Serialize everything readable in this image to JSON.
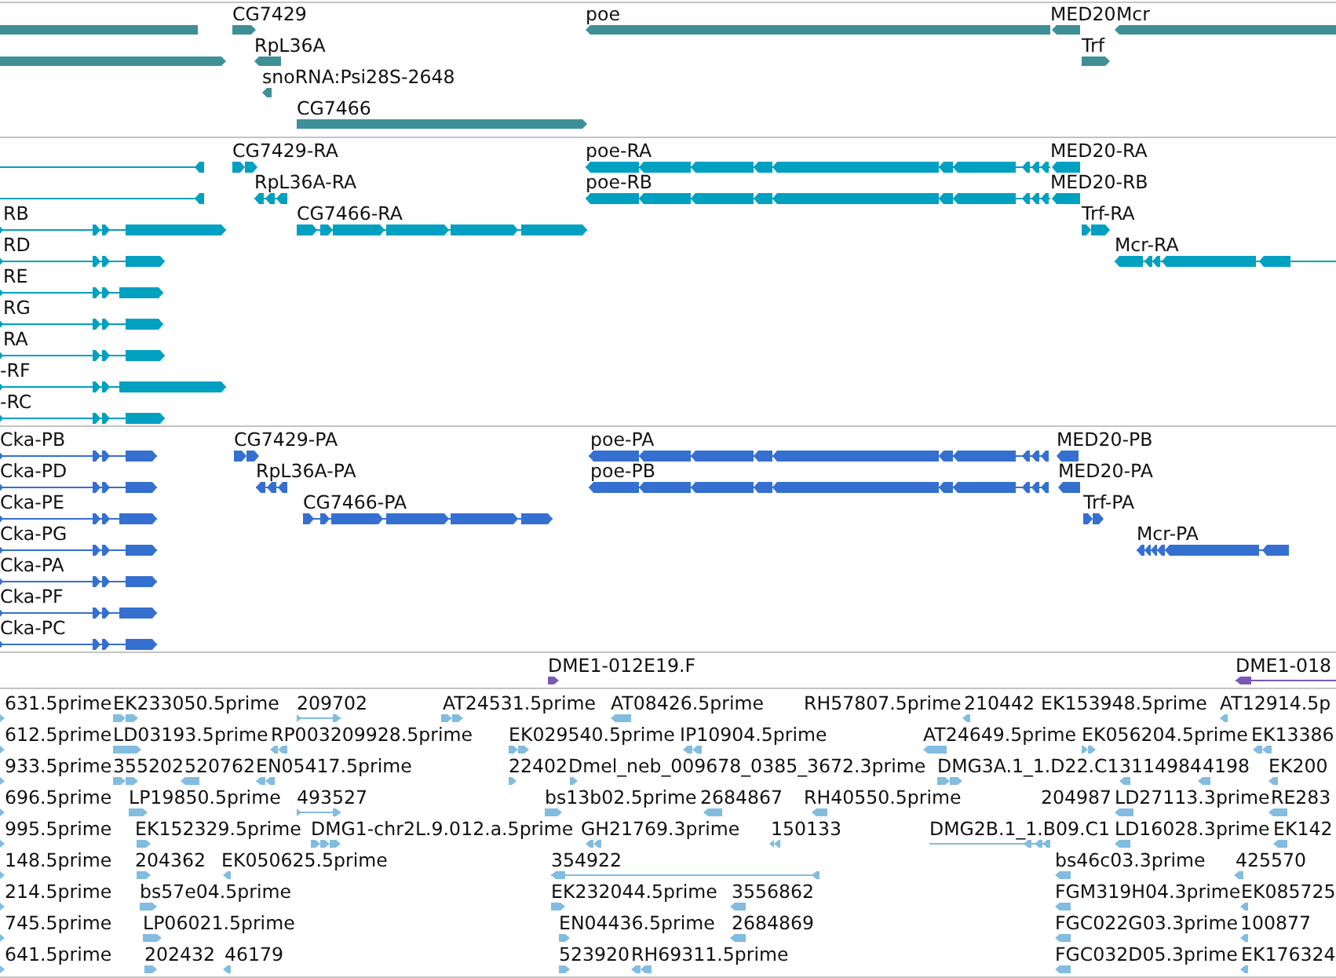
{
  "tracks": [
    {
      "kind": "gene",
      "rows": [
        {
          "features": [
            {
              "reverse": true
            },
            {
              "label": "CG7429",
              "reverse": false
            },
            {
              "label": "poe",
              "reverse": true
            },
            {
              "label": "MED20",
              "reverse": true
            },
            {
              "label": "Mcr",
              "reverse": true
            }
          ]
        },
        {
          "features": [
            {
              "reverse": false
            },
            {
              "label": "RpL36A",
              "reverse": true
            },
            {
              "label": "Trf",
              "reverse": false
            }
          ]
        },
        {
          "features": [
            {
              "label": "snoRNA:Psi28S-2648",
              "reverse": true
            }
          ]
        },
        {
          "features": [
            {
              "label": "CG7466",
              "reverse": false
            }
          ]
        }
      ]
    },
    {
      "kind": "transcript",
      "rows": [
        {
          "features": [
            {
              "reverse": true
            },
            {
              "label": "CG7429-RA",
              "reverse": false
            },
            {
              "label": "poe-RA",
              "reverse": true
            },
            {
              "label": "MED20-RA",
              "reverse": true
            }
          ]
        },
        {
          "features": [
            {
              "reverse": true
            },
            {
              "label": "RpL36A-RA",
              "reverse": true
            },
            {
              "label": "poe-RB",
              "reverse": true
            },
            {
              "label": "MED20-RB",
              "reverse": true
            }
          ]
        },
        {
          "features": [
            {
              "label": "RB",
              "reverse": false
            },
            {
              "label": "CG7466-RA",
              "reverse": false
            },
            {
              "label": "Trf-RA",
              "reverse": false
            }
          ]
        },
        {
          "features": [
            {
              "label": "RD",
              "reverse": false
            },
            {
              "label": "Mcr-RA",
              "reverse": true
            }
          ]
        },
        {
          "features": [
            {
              "label": "RE",
              "reverse": false
            }
          ]
        },
        {
          "features": [
            {
              "label": "RG",
              "reverse": false
            }
          ]
        },
        {
          "features": [
            {
              "label": "RA",
              "reverse": false
            }
          ]
        },
        {
          "features": [
            {
              "label": "-RF",
              "reverse": false
            }
          ]
        },
        {
          "features": [
            {
              "label": "-RC",
              "reverse": false
            }
          ]
        }
      ]
    },
    {
      "kind": "protein",
      "rows": [
        {
          "features": [
            {
              "label": "Cka-PB",
              "reverse": false
            },
            {
              "label": "CG7429-PA",
              "reverse": false
            },
            {
              "label": "poe-PA",
              "reverse": true
            },
            {
              "label": "MED20-PB",
              "reverse": true
            }
          ]
        },
        {
          "features": [
            {
              "label": "Cka-PD",
              "reverse": false
            },
            {
              "label": "RpL36A-PA",
              "reverse": true
            },
            {
              "label": "poe-PB",
              "reverse": true
            },
            {
              "label": "MED20-PA",
              "reverse": true
            }
          ]
        },
        {
          "features": [
            {
              "label": "Cka-PE",
              "reverse": false
            },
            {
              "label": "CG7466-PA",
              "reverse": false
            },
            {
              "label": "Trf-PA",
              "reverse": false
            }
          ]
        },
        {
          "features": [
            {
              "label": "Cka-PG",
              "reverse": false
            },
            {
              "label": "Mcr-PA",
              "reverse": true
            }
          ]
        },
        {
          "features": [
            {
              "label": "Cka-PA",
              "reverse": false
            }
          ]
        },
        {
          "features": [
            {
              "label": "Cka-PF",
              "reverse": false
            }
          ]
        },
        {
          "features": [
            {
              "label": "Cka-PC",
              "reverse": false
            }
          ]
        }
      ]
    },
    {
      "kind": "clone",
      "rows": [
        {
          "features": [
            {
              "label": "DME1-012E19.F",
              "reverse": false
            },
            {
              "label": "DME1-018",
              "reverse": true
            }
          ]
        }
      ]
    },
    {
      "kind": "est",
      "rows": [
        {
          "features": [
            {
              "label": "631.5prime",
              "reverse": false
            },
            {
              "label": "EK233050.5prime",
              "reverse": false
            },
            {
              "label": "209702",
              "reverse": false
            },
            {
              "label": "AT24531.5prime",
              "reverse": false
            },
            {
              "label": "AT08426.5prime",
              "reverse": true
            },
            {
              "label": "RH57807.5prime"
            },
            {
              "label": "210442",
              "reverse": true
            },
            {
              "label": "EK153948.5prime"
            },
            {
              "label": "AT12914.5p",
              "reverse": true
            }
          ]
        },
        {
          "features": [
            {
              "label": "612.5prime",
              "reverse": false
            },
            {
              "label": "LD03193.5prime",
              "reverse": false
            },
            {
              "label": "RP003209928.5prime",
              "reverse": true
            },
            {
              "label": "EK029540.5prime",
              "reverse": false
            },
            {
              "label": "IP10904.5prime",
              "reverse": true
            },
            {
              "label": "AT24649.5prime",
              "reverse": true
            },
            {
              "label": "EK056204.5prime",
              "reverse": false
            },
            {
              "label": "EK13386",
              "reverse": true
            }
          ]
        },
        {
          "features": [
            {
              "label": "933.5prime",
              "reverse": false
            },
            {
              "label": "355202",
              "reverse": false
            },
            {
              "label": "520762",
              "reverse": true
            },
            {
              "label": "EN05417.5prime",
              "reverse": true
            },
            {
              "label": "22402",
              "reverse": false
            },
            {
              "label": "Dmel_neb_009678_0385_3672.3prime",
              "reverse": false
            },
            {
              "label": "DMG3A.1_1.D22.C1",
              "reverse": false
            },
            {
              "label": "3114984",
              "reverse": true
            },
            {
              "label": "4198",
              "reverse": true
            },
            {
              "label": "EK200",
              "reverse": true
            }
          ]
        },
        {
          "features": [
            {
              "label": "696.5prime",
              "reverse": false
            },
            {
              "label": "LP19850.5prime",
              "reverse": false
            },
            {
              "label": "493527",
              "reverse": false
            },
            {
              "label": "bs13b02.5prime",
              "reverse": false
            },
            {
              "label": "2684867",
              "reverse": true
            },
            {
              "label": "RH40550.5prime",
              "reverse": true
            },
            {
              "label": "204987"
            },
            {
              "label": "LD27113.3prime",
              "reverse": true
            },
            {
              "label": "RE283",
              "reverse": true
            }
          ]
        },
        {
          "features": [
            {
              "label": "995.5prime",
              "reverse": false
            },
            {
              "label": "EK152329.5prime",
              "reverse": false
            },
            {
              "label": "DMG1-chr2L.9.012.a.5prime",
              "reverse": false
            },
            {
              "label": "GH21769.3prime",
              "reverse": true
            },
            {
              "label": "150133",
              "reverse": true
            },
            {
              "label": "DMG2B.1_1.B09.C1",
              "reverse": true
            },
            {
              "label": "LD16028.3prime",
              "reverse": true
            },
            {
              "label": "EK142",
              "reverse": true
            }
          ]
        },
        {
          "features": [
            {
              "label": "148.5prime",
              "reverse": false
            },
            {
              "label": "204362",
              "reverse": false
            },
            {
              "label": "EK050625.5prime",
              "reverse": true
            },
            {
              "label": "354922",
              "reverse": true
            },
            {
              "label": "bs46c03.3prime",
              "reverse": true
            },
            {
              "label": "425570",
              "reverse": true
            }
          ]
        },
        {
          "features": [
            {
              "label": "214.5prime",
              "reverse": false
            },
            {
              "label": "bs57e04.5prime",
              "reverse": false
            },
            {
              "label": "EK232044.5prime",
              "reverse": false
            },
            {
              "label": "3556862",
              "reverse": true
            },
            {
              "label": "FGM319H04.3prime",
              "reverse": true
            },
            {
              "label": "EK085725",
              "reverse": true
            }
          ]
        },
        {
          "features": [
            {
              "label": "745.5prime",
              "reverse": false
            },
            {
              "label": "LP06021.5prime",
              "reverse": false
            },
            {
              "label": "EN04436.5prime",
              "reverse": false
            },
            {
              "label": "2684869",
              "reverse": true
            },
            {
              "label": "FGC022G03.3prime",
              "reverse": true
            },
            {
              "label": "100877",
              "reverse": true
            }
          ]
        },
        {
          "features": [
            {
              "label": "641.5prime",
              "reverse": false
            },
            {
              "label": "202432",
              "reverse": false
            },
            {
              "label": "46179",
              "reverse": true
            },
            {
              "label": "523920",
              "reverse": false
            },
            {
              "label": "RH69311.5prime",
              "reverse": true
            },
            {
              "label": "FGC032D05.3prime",
              "reverse": true
            },
            {
              "label": "EK176324",
              "reverse": true
            }
          ]
        }
      ]
    }
  ]
}
